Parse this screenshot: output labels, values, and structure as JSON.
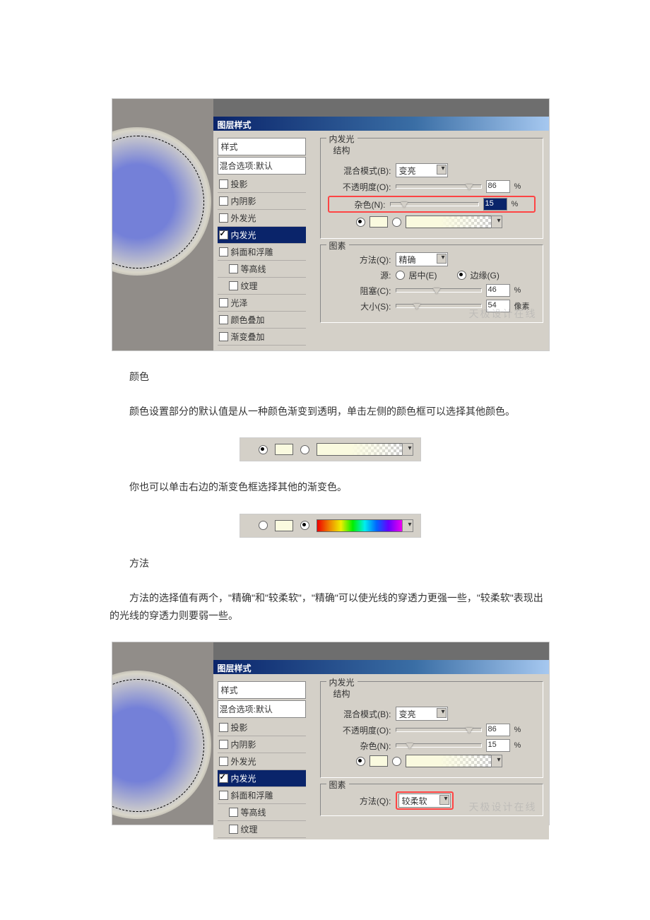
{
  "article": {
    "h_color": "颜色",
    "p_color": "颜色设置部分的默认值是从一种颜色渐变到透明，单击左侧的颜色框可以选择其他颜色。",
    "p_gradient": "你也可以单击右边的渐变色框选择其他的渐变色。",
    "h_method": "方法",
    "p_method": "方法的选择值有两个，\"精确\"和\"较柔软\"，\"精确\"可以使光线的穿透力更强一些，\"较柔软\"表现出的光线的穿透力则要弱一些。"
  },
  "ps": {
    "dialog_title": "图层样式",
    "styles": {
      "header": "样式",
      "blend": "混合选项:默认",
      "drop_shadow": "投影",
      "inner_shadow": "内阴影",
      "outer_glow": "外发光",
      "inner_glow": "内发光",
      "bevel": "斜面和浮雕",
      "contour": "等高线",
      "texture": "纹理",
      "satin": "光泽",
      "color_overlay": "颜色叠加",
      "gradient_overlay": "渐变叠加"
    },
    "panel": {
      "group_label": "内发光",
      "structure_label": "结构",
      "elements_label": "图素",
      "blend_mode_label": "混合模式(B):",
      "blend_mode_value": "变亮",
      "opacity_label": "不透明度(O):",
      "opacity_value": "86",
      "percent": "%",
      "noise_label": "杂色(N):",
      "noise_value": "15",
      "method_label": "方法(Q):",
      "method_value_precise": "精确",
      "method_value_soft": "较柔软",
      "source_label": "源:",
      "source_center": "居中(E)",
      "source_edge": "边缘(G)",
      "choke_label": "阻塞(C):",
      "choke_value": "46",
      "size_label": "大小(S):",
      "size_value": "54",
      "px": "像素"
    }
  }
}
